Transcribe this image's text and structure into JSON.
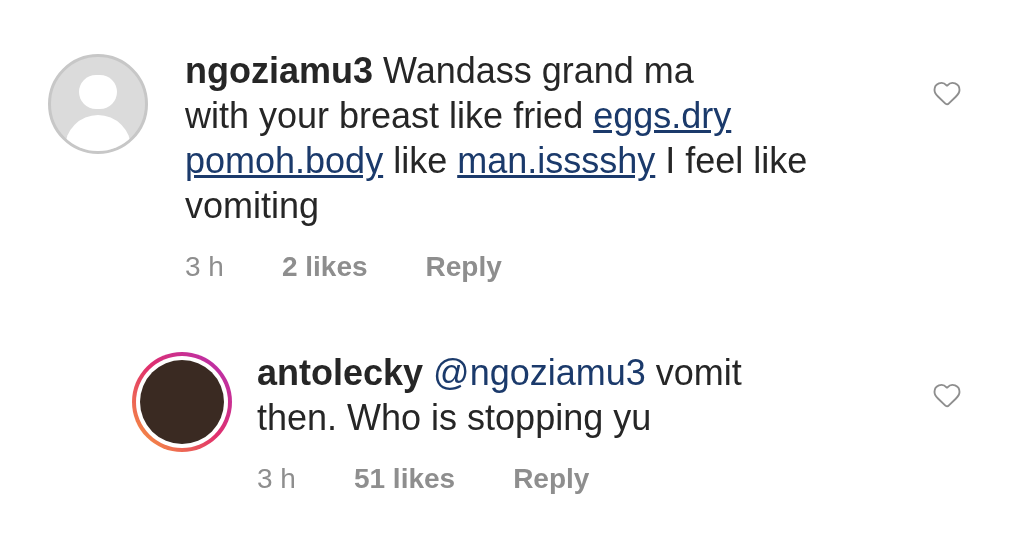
{
  "comments": [
    {
      "username": "ngoziamu3",
      "story_ring": false,
      "liked": false,
      "segments": [
        {
          "kind": "text",
          "text": "Wandass grand ma\nwith your breast like fried"
        },
        {
          "kind": "link",
          "text": "eggs.dry"
        },
        {
          "kind": "link",
          "text": "pomoh.body"
        },
        {
          "kind": "text",
          "text": "like"
        },
        {
          "kind": "link",
          "text": "man.isssshy"
        },
        {
          "kind": "text",
          "text": "I feel like vomiting"
        }
      ],
      "time": "3 h",
      "likes": "2 likes",
      "reply": "Reply",
      "children": [
        {
          "username": "antolecky",
          "story_ring": true,
          "liked": false,
          "segments": [
            {
              "kind": "mention",
              "text": "@ngoziamu3"
            },
            {
              "kind": "text",
              "text": "vomit then. Who is stopping yu"
            }
          ],
          "time": "3 h",
          "likes": "51 likes",
          "reply": "Reply"
        }
      ]
    }
  ]
}
